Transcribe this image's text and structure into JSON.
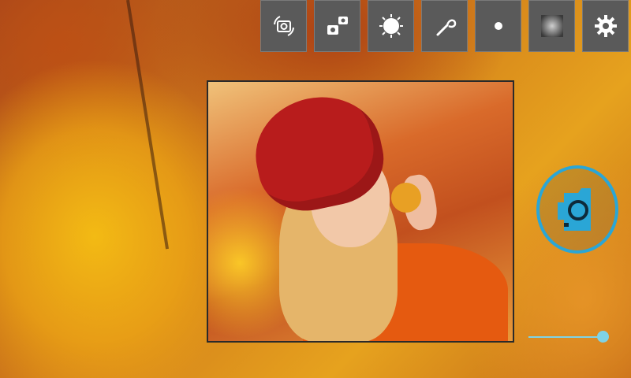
{
  "toolbar": {
    "buttons": [
      {
        "name": "rotate-camera",
        "icon": "rotate-camera-icon"
      },
      {
        "name": "switch-camera",
        "icon": "switch-camera-icon"
      },
      {
        "name": "brightness",
        "icon": "sun-icon"
      },
      {
        "name": "effects",
        "icon": "wand-icon"
      },
      {
        "name": "dot-mode",
        "icon": "dot-icon"
      },
      {
        "name": "vignette",
        "icon": "vignette-icon"
      },
      {
        "name": "settings",
        "icon": "gear-icon"
      }
    ]
  },
  "shutter": {
    "icon": "camera-icon",
    "color": "#2aa6d6"
  },
  "slider": {
    "value": 1.0,
    "color": "#7fd3e6"
  },
  "colors": {
    "toolbar_bg": "#5a5a5a",
    "accent": "#2aa6d6"
  }
}
